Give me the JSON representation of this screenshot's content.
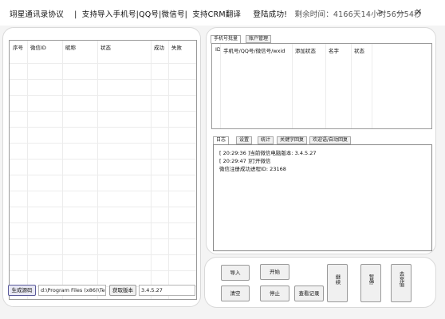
{
  "title": {
    "app_name": "翊星通讯录协议",
    "sep": "|",
    "feature1": "支持导入手机号|QQ号|微信号|",
    "feature2": "支持CRM翻译",
    "login_status": "登陆成功!",
    "remaining_time": "剩余时间：4166天14小时56分54秒",
    "more_label": ">",
    "minimize_label": "—",
    "close_label": "✕"
  },
  "left_table": {
    "columns": [
      "序号",
      "微信ID",
      "昵称",
      "状态",
      "成功",
      "失败"
    ]
  },
  "left_bottom": {
    "set_button": "生成源码",
    "path_value": "d:\\Program Files (x86)\\Te",
    "version_button": "获取版本",
    "version_value": "3.4.5.27"
  },
  "top_tabs": [
    "手机号批量",
    "账户管理"
  ],
  "right_table": {
    "columns": [
      "ID",
      "手机号/QQ号/微信号/wxid",
      "添加状态",
      "名字",
      "状态"
    ]
  },
  "log_tabs": [
    "日志",
    "设置",
    "统计",
    "关键字回复",
    "欢迎语/自动回复"
  ],
  "log_lines": [
    "[ 20:29:36 ]当前微信电脑版本: 3.4.5.27",
    "[ 20:29:47 ]打开微信",
    "微信注册成功进程ID: 23168"
  ],
  "buttons": {
    "import": "导入",
    "start": "开始",
    "clear": "清空",
    "stop": "停止",
    "view_record": "查看记录",
    "continue": "继续",
    "pause": "暂停",
    "recharge": "去充值"
  }
}
